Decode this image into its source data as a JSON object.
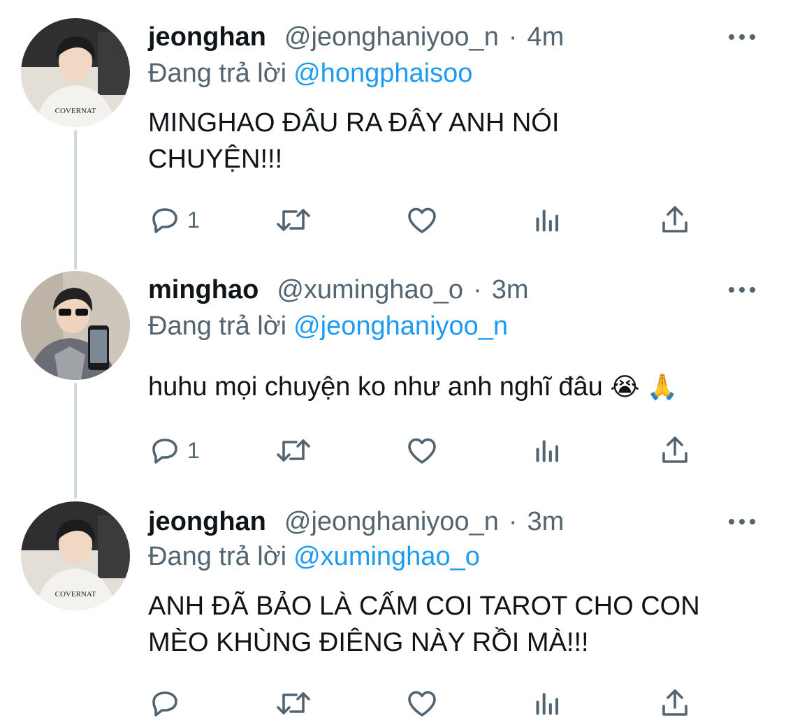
{
  "tweets": [
    {
      "name": "jeonghan",
      "handle": "@jeonghaniyoo_n",
      "time": "4m",
      "reply_prefix": "Đang trả lời",
      "reply_to": "@hongphaisoo",
      "text": "MINGHAO ĐÂU RA ĐÂY ANH NÓI CHUYỆN!!!",
      "reply_count": "1",
      "avatar_shirt_text": "COVERNAT"
    },
    {
      "name": "minghao",
      "handle": "@xuminghao_o",
      "time": "3m",
      "reply_prefix": "Đang trả lời",
      "reply_to": "@jeonghaniyoo_n",
      "text": "huhu mọi chuyện ko như anh nghĩ đâu",
      "emojis": "😭 🙏",
      "reply_count": "1"
    },
    {
      "name": "jeonghan",
      "handle": "@jeonghaniyoo_n",
      "time": "3m",
      "reply_prefix": "Đang trả lời",
      "reply_to": "@xuminghao_o",
      "text": "ANH ĐÃ BẢO LÀ CẤM COI TAROT CHO CON MÈO KHÙNG ĐIÊNG NÀY RỒI MÀ!!!",
      "reply_count": "",
      "avatar_shirt_text": "COVERNAT"
    }
  ],
  "separator": "·",
  "icons": [
    "reply-icon",
    "retweet-icon",
    "like-icon",
    "views-icon",
    "share-icon",
    "more-icon"
  ],
  "colors": {
    "text": "#0f1419",
    "secondary": "#536471",
    "link": "#1d9bf0",
    "thread_line": "#cfd9de"
  }
}
